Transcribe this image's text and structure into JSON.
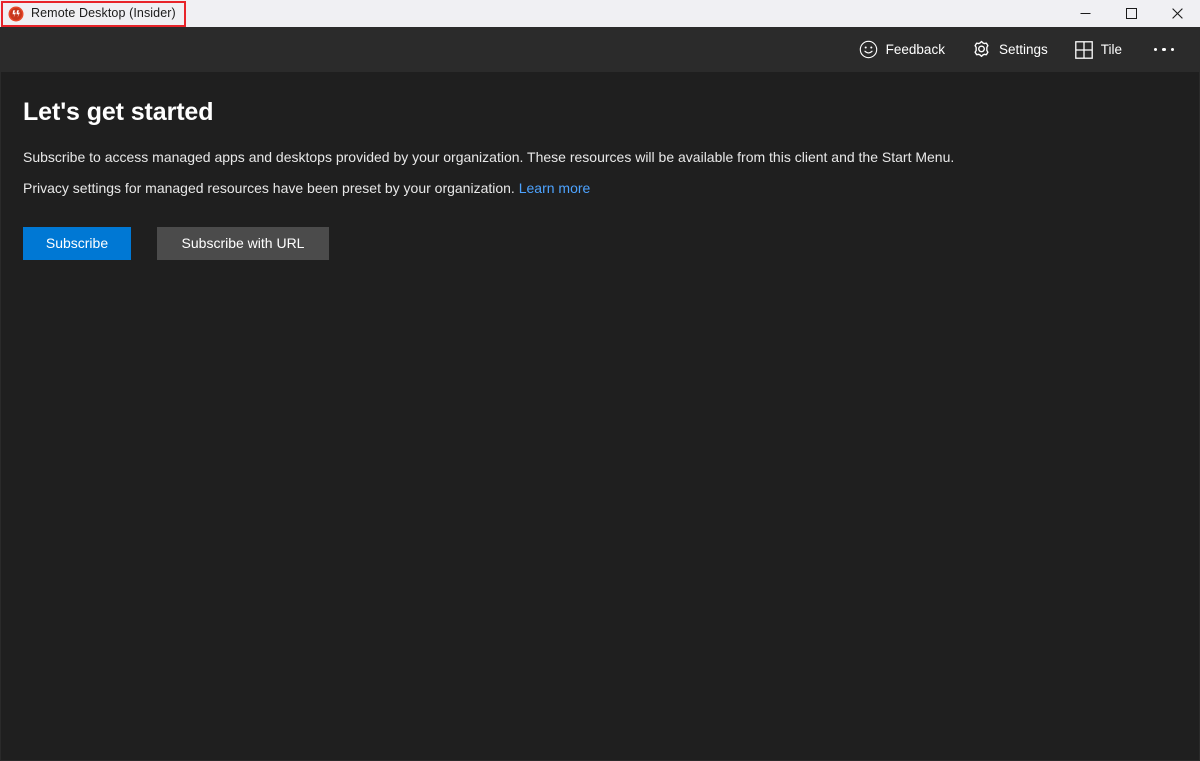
{
  "window": {
    "title": "Remote Desktop (Insider)",
    "app_icon": "remote-desktop-icon",
    "controls": {
      "minimize": "Minimize",
      "maximize": "Maximize",
      "close": "Close"
    }
  },
  "annotation": {
    "color": "#e8242a",
    "target": "window-title"
  },
  "toolbar": {
    "items": [
      {
        "icon": "smiley-face-icon",
        "label": "Feedback"
      },
      {
        "icon": "gear-icon",
        "label": "Settings"
      },
      {
        "icon": "grid-tile-icon",
        "label": "Tile"
      }
    ],
    "more_label": "More options"
  },
  "main": {
    "heading": "Let's get started",
    "paragraph_1": "Subscribe to access managed apps and desktops provided by your organization. These resources will be available from this client and the Start Menu.",
    "paragraph_2_text": "Privacy settings for managed resources have been preset by your organization.",
    "paragraph_2_link": "Learn more",
    "buttons": {
      "primary": "Subscribe",
      "secondary": "Subscribe with URL"
    }
  },
  "colors": {
    "titlebar_background": "#f0f0f3",
    "toolbar_background": "#2b2b2b",
    "content_background": "#1f1f1f",
    "accent": "#0078d4",
    "secondary_button": "#4b4b4b",
    "link": "#4da3ff",
    "annotation": "#e8242a",
    "app_icon_red": "#d83b01"
  }
}
